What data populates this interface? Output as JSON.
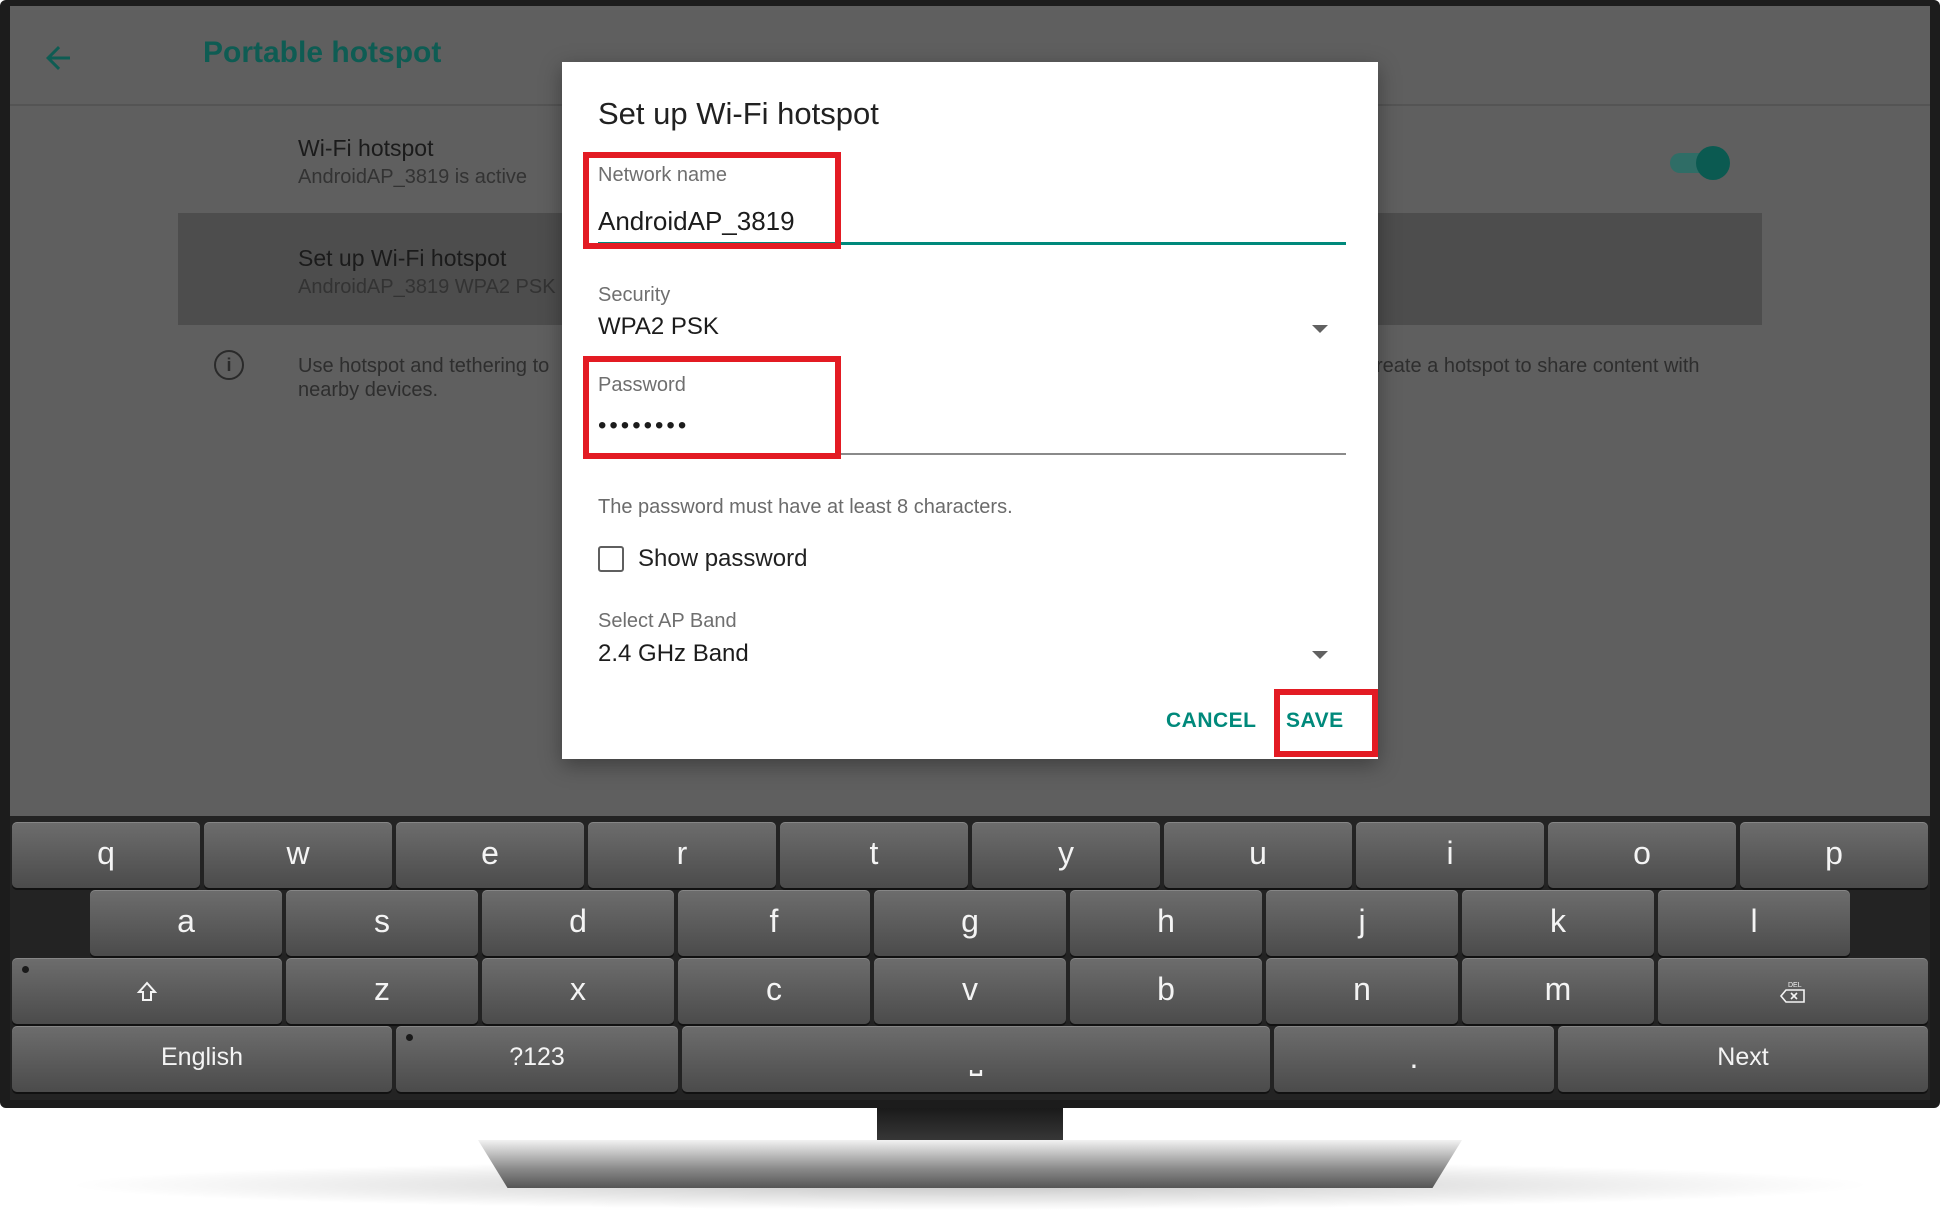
{
  "app": {
    "title": "Portable hotspot",
    "back_icon": "arrow-left-icon"
  },
  "settings": {
    "wifi_hotspot_title": "Wi-Fi hotspot",
    "wifi_hotspot_sub": "AndroidAP_3819 is active",
    "wifi_hotspot_enabled": true,
    "setup_title": "Set up Wi-Fi hotspot",
    "setup_sub": "AndroidAP_3819 WPA2 PSK",
    "info_line1_left": "Use hotspot and tethering to",
    "info_line1_right": "reate a hotspot to share content with",
    "info_line2": "nearby devices."
  },
  "dialog": {
    "title": "Set up Wi-Fi hotspot",
    "network_name_label": "Network name",
    "network_name_value": "AndroidAP_3819",
    "security_label": "Security",
    "security_value": "WPA2 PSK",
    "password_label": "Password",
    "password_value": "••••••••",
    "password_helper": "The password must have at least 8 characters.",
    "show_password_label": "Show password",
    "show_password_checked": false,
    "ap_band_label": "Select AP Band",
    "ap_band_value": "2.4 GHz Band",
    "cancel_label": "CANCEL",
    "save_label": "SAVE"
  },
  "keyboard": {
    "row1": [
      "q",
      "w",
      "e",
      "r",
      "t",
      "y",
      "u",
      "i",
      "o",
      "p"
    ],
    "row2": [
      "a",
      "s",
      "d",
      "f",
      "g",
      "h",
      "j",
      "k",
      "l"
    ],
    "row3": [
      "z",
      "x",
      "c",
      "v",
      "b",
      "n",
      "m"
    ],
    "shift_icon": "shift-arrow-icon",
    "delete_icon": "backspace-del-icon",
    "delete_glyph": "DEL",
    "language_label": "English",
    "symbols_label": "?123",
    "space_glyph": "⎵",
    "period_label": ".",
    "next_label": "Next"
  },
  "colors": {
    "accent": "#00897b",
    "title_green": "#0e5c53",
    "highlight_red": "#e31b23"
  }
}
